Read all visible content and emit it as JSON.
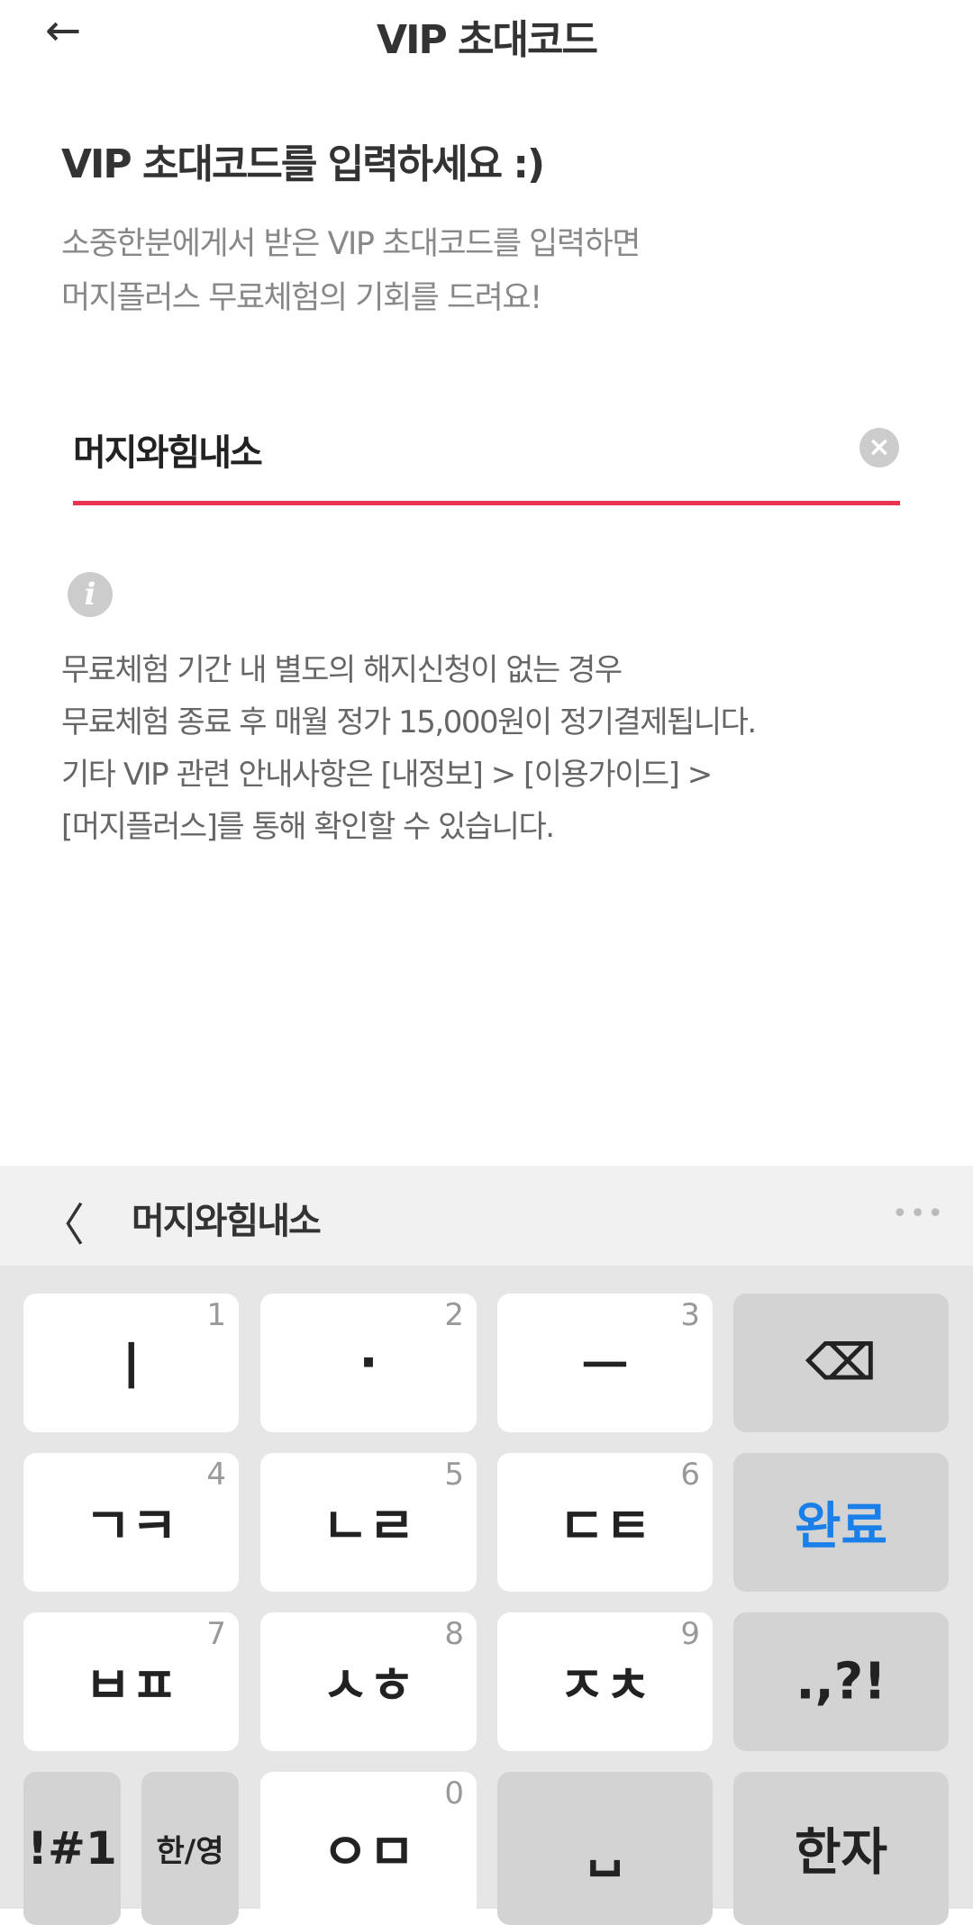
{
  "header": {
    "back_icon": "arrow-left-icon",
    "title": "VIP 초대코드"
  },
  "main": {
    "heading": "VIP 초대코드를 입력하세요 :)",
    "subtitle": [
      "소중한분에게서 받은 VIP 초대코드를 입력하면",
      "머지플러스 무료체험의 기회를 드려요!"
    ],
    "input_value": "머지와힘내소",
    "clear_icon": "clear-circle-icon",
    "accent": "#e8334f",
    "info_icon": "info-icon",
    "notice": [
      "무료체험 기간 내 별도의 해지신청이 없는 경우",
      "무료체험 종료 후 매월 정가 15,000원이 정기결제됩니다.",
      "기타 VIP 관련 안내사항은 [내정보] > [이용가이드] >",
      "[머지플러스]를 통해 확인할 수 있습니다."
    ]
  },
  "keyboard": {
    "composing": "머지와힘내소",
    "more": "•••",
    "back": "〈",
    "keys": [
      {
        "label": "ㅣ",
        "num": "1"
      },
      {
        "label": "·",
        "num": "2"
      },
      {
        "label": "ㅡ",
        "num": "3"
      },
      {
        "label": "⌫",
        "num": ""
      },
      {
        "label": "ㄱㅋ",
        "num": "4"
      },
      {
        "label": "ㄴㄹ",
        "num": "5"
      },
      {
        "label": "ㄷㅌ",
        "num": "6"
      },
      {
        "label": "완료",
        "num": ""
      },
      {
        "label": "ㅂㅍ",
        "num": "7"
      },
      {
        "label": "ㅅㅎ",
        "num": "8"
      },
      {
        "label": "ㅈㅊ",
        "num": "9"
      },
      {
        "label": ".,?!",
        "num": ""
      },
      {
        "label": "!#1",
        "num": ""
      },
      {
        "label": "한/영",
        "num": ""
      },
      {
        "label": "ㅇㅁ",
        "num": "0"
      },
      {
        "label": "␣",
        "num": ""
      },
      {
        "label": "한자",
        "num": ""
      }
    ],
    "done_color": "#1a7fe8"
  }
}
